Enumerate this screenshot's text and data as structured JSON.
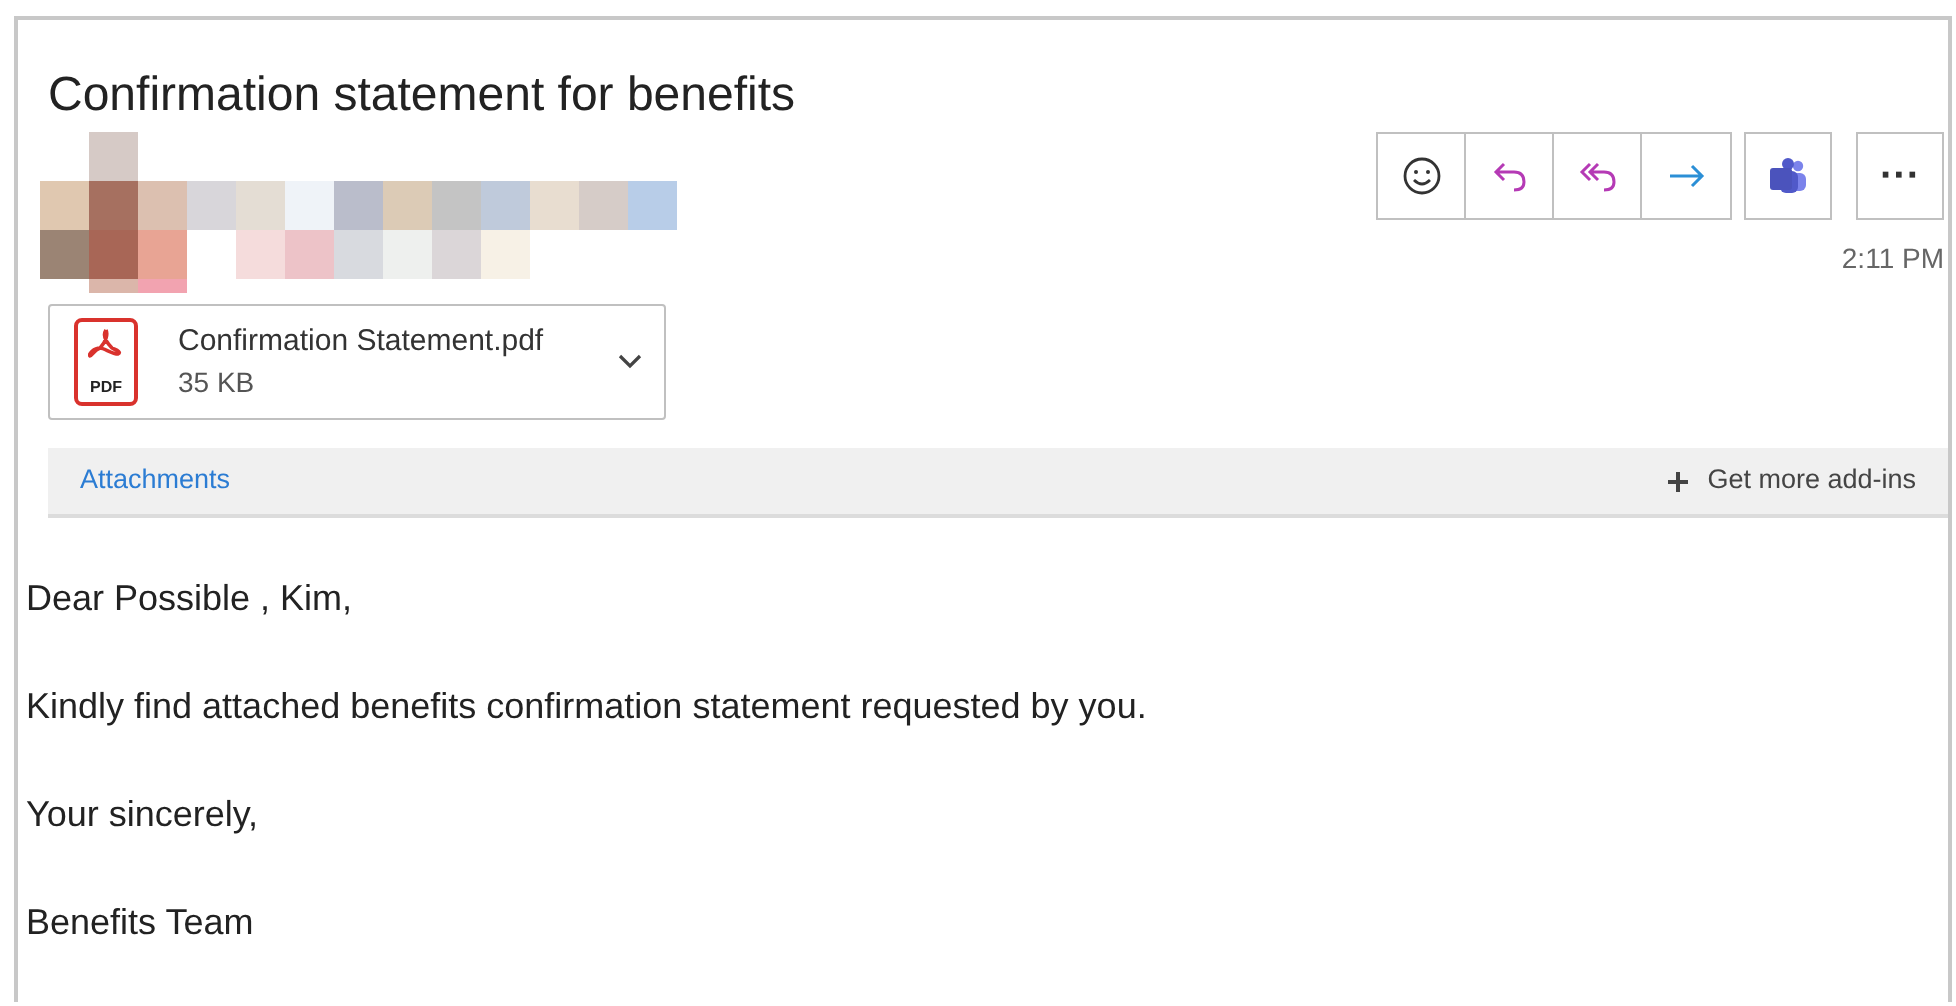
{
  "subject": "Confirmation statement for benefits",
  "actions": [
    {
      "kind": "emoji"
    },
    {
      "kind": "reply"
    },
    {
      "kind": "reply_all"
    },
    {
      "kind": "forward"
    },
    {
      "kind": "teams"
    },
    {
      "kind": "more",
      "label": "···"
    }
  ],
  "time": "2:11 PM",
  "attachment": {
    "name": "Confirmation Statement.pdf",
    "size": "35 KB",
    "type_label": "PDF"
  },
  "addin_bar": {
    "link": "Attachments",
    "button": "Get more add-ins"
  },
  "body": [
    "Dear Possible , Kim,",
    "Kindly find attached benefits confirmation statement requested by you.",
    "Your sincerely,",
    "Benefits Team"
  ]
}
